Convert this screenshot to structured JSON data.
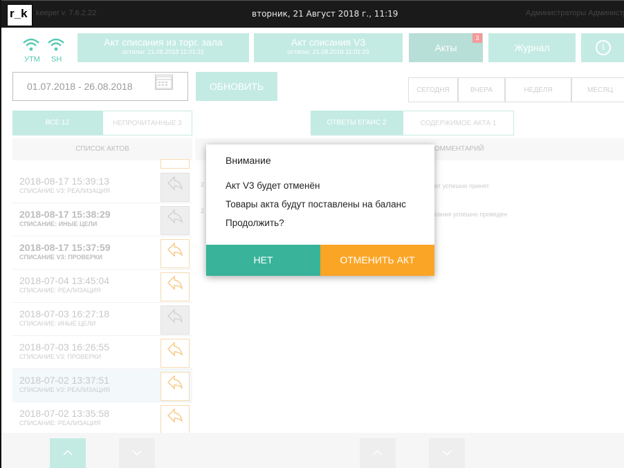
{
  "titlebar": {
    "logo": "r_k",
    "version": "keeper v. 7.6.2.22",
    "datetime": "вторник, 21 Август 2018 г., 11:19",
    "user": "Администраторы Администрат"
  },
  "topnav": {
    "utm_label": "УТМ",
    "sh_label": "SH",
    "tiles": [
      {
        "title": "Акт списания из торг. зала",
        "subtitle": "остатки: 21.08.2018 11:01:31"
      },
      {
        "title": "Акт списания V3",
        "subtitle": "остатки: 21.08.2018 11:01:29"
      },
      {
        "title": "Акты",
        "badge": "3"
      },
      {
        "title": "Журнал"
      }
    ],
    "info_icon": "i"
  },
  "filters": {
    "date_range": "01.07.2018 - 26.08.2018",
    "refresh": "ОБНОВИТЬ",
    "ranges": [
      "СЕГОДНЯ",
      "ВЧЕРА",
      "НЕДЕЛЯ",
      "МЕСЯЦ"
    ]
  },
  "left_tabs": {
    "all": "ВСЕ  12",
    "unread": "НЕПРОЧИТАННЫЕ  3"
  },
  "right_tabs": {
    "egais": "ОТВЕТЫ ЕГАИС  2",
    "contents": "СОДЕРЖИМОЕ АКТА  1"
  },
  "list_header": "СПИСОК АКТОВ",
  "comment_header": "КОММЕНТАРИЙ",
  "acts": [
    {
      "datetime": "2018-08-17   15:39:13",
      "type": "СПИСАНИЕ V3: РЕАЛИЗАЦИЯ",
      "bold": false
    },
    {
      "datetime": "2018-08-17   15:38:29",
      "type": "СПИСАНИЕ: ИНЫЕ ЦЕЛИ",
      "bold": true
    },
    {
      "datetime": "2018-08-17   15:37:59",
      "type": "СПИСАНИЕ V3: ПРОВЕРКИ",
      "bold": true
    },
    {
      "datetime": "2018-07-04   13:45:04",
      "type": "СПИСАНИЕ: РЕАЛИЗАЦИЯ",
      "bold": false
    },
    {
      "datetime": "2018-07-03   16:27:18",
      "type": "СПИСАНИЕ: ИНЫЕ ЦЕЛИ",
      "bold": false
    },
    {
      "datetime": "2018-07-03   16:26:55",
      "type": "СПИСАНИЕ V3: ПРОВЕРКИ",
      "bold": false
    },
    {
      "datetime": "2018-07-02   13:37:51",
      "type": "СПИСАНИЕ V3: РЕАЛИЗАЦИЯ",
      "bold": false
    },
    {
      "datetime": "2018-07-02   13:35:58",
      "type": "СПИСАНИЕ: РЕАЛИЗАЦИЯ",
      "bold": false
    }
  ],
  "messages": [
    {
      "prefix": "2",
      "text": "нт успешно принят."
    },
    {
      "prefix": "2",
      "text": "сания успешно проведен"
    }
  ],
  "modal": {
    "title": "Внимание",
    "line1": "Акт V3 будет отменён",
    "line2": "Товары акта будут поставлены на баланс",
    "line3": "Продолжить?",
    "no": "НЕТ",
    "cancel": "ОТМЕНИТЬ АКТ"
  },
  "colors": {
    "teal": "#39b49a",
    "teal_light": "#c4ebe3",
    "orange": "#fba526",
    "badge": "#f39a9a"
  }
}
